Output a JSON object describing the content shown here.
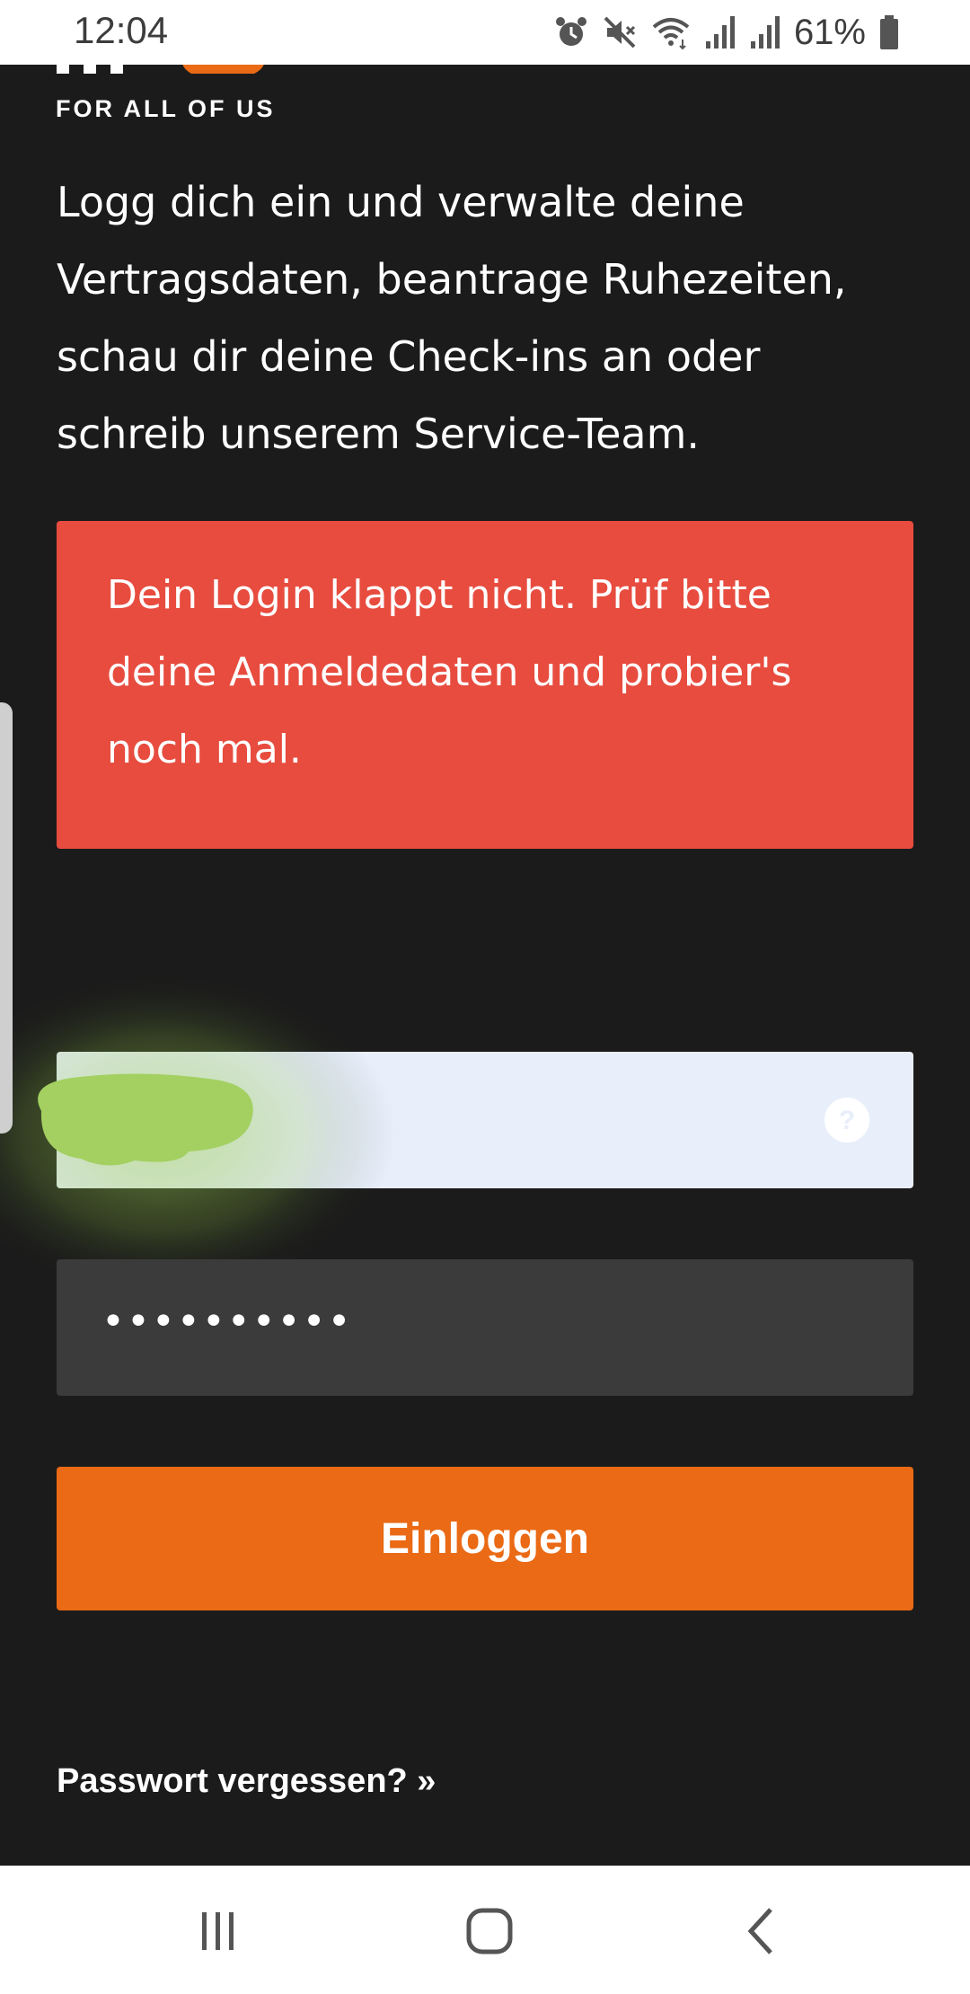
{
  "status_bar": {
    "time": "12:04",
    "battery": "61%",
    "icons": [
      "alarm-icon",
      "mute-icon",
      "wifi-icon",
      "signal-icon",
      "signal-icon",
      "battery-icon"
    ]
  },
  "brand": {
    "tagline": "FOR ALL OF US",
    "accent_color": "#ea6a15"
  },
  "intro": {
    "line1": "Logg dich ein und verwalte deine",
    "line2": "Vertragsdaten, beantrage Ruhezeiten,",
    "line3": "schau dir deine Check-ins an oder",
    "line4": "schreib unserem Service-Team."
  },
  "error": {
    "line1": "Dein Login klappt nicht. Prüf bitte",
    "line2": "deine Anmeldedaten und probier's",
    "line3": "noch mal.",
    "color": "#e74c3f"
  },
  "form": {
    "username_value": "",
    "password_value": "••••••••••",
    "login_label": "Einloggen",
    "forgot_label": "Passwort vergessen? »"
  },
  "nav": {
    "items": [
      "recent-apps-icon",
      "home-icon",
      "back-icon"
    ]
  }
}
